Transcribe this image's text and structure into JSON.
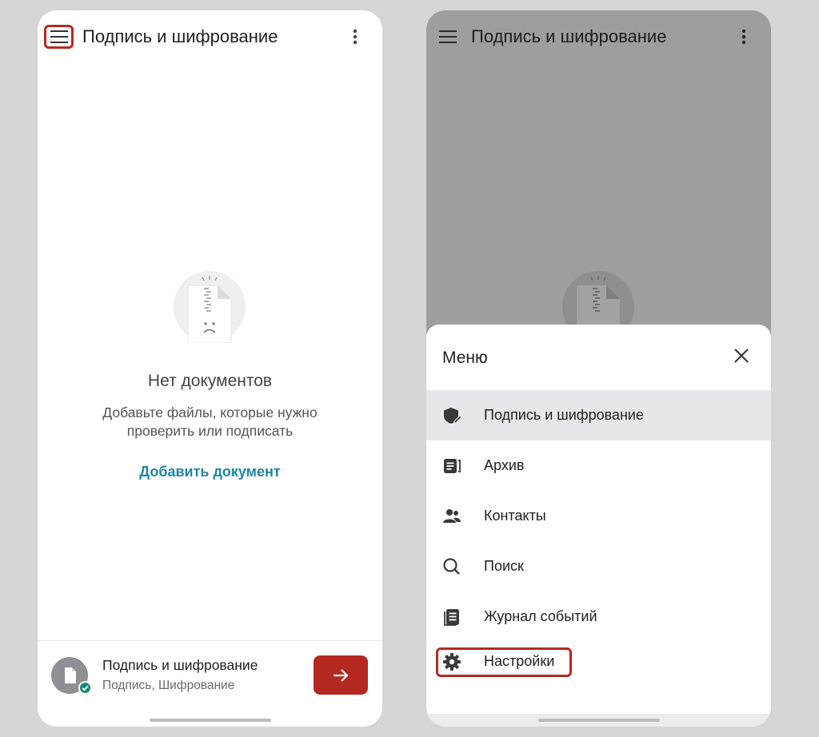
{
  "left_screen": {
    "app_title": "Подпись и шифрование",
    "empty_state": {
      "title": "Нет документов",
      "subtitle": "Добавьте файлы, которые нужно проверить или подписать",
      "add_link": "Добавить документ"
    },
    "bottom_bar": {
      "title": "Подпись и шифрование",
      "subtitle": "Подпись, Шифрование"
    }
  },
  "right_screen": {
    "app_title": "Подпись и шифрование",
    "menu": {
      "title": "Меню",
      "items": [
        {
          "label": "Подпись и шифрование",
          "icon": "shield-pen-icon",
          "active": true
        },
        {
          "label": "Архив",
          "icon": "archive-icon",
          "active": false
        },
        {
          "label": "Контакты",
          "icon": "contacts-icon",
          "active": false
        },
        {
          "label": "Поиск",
          "icon": "search-icon",
          "active": false
        },
        {
          "label": "Журнал событий",
          "icon": "event-log-icon",
          "active": false
        },
        {
          "label": "Настройки",
          "icon": "gear-icon",
          "active": false
        }
      ]
    }
  },
  "colors": {
    "accent_red": "#b3291f",
    "link_blue": "#1f87a8",
    "check_green": "#1a8b78",
    "highlight_border": "#b22b22"
  }
}
